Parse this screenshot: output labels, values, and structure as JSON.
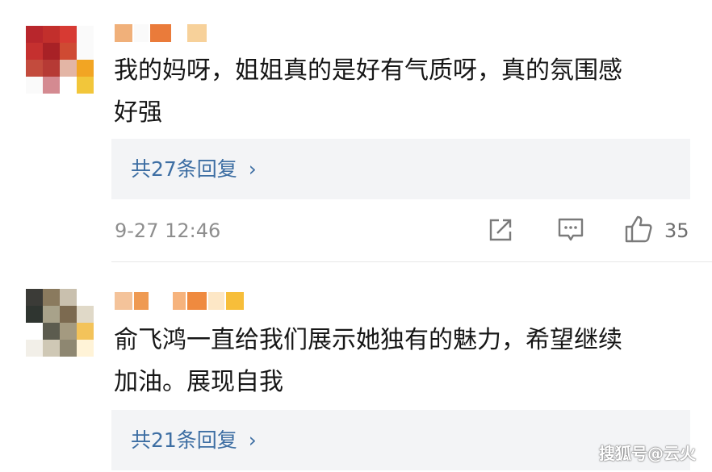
{
  "comments": [
    {
      "text_line1": "我的妈呀，姐姐真的是好有气质呀，真的氛围感",
      "text_line2": "好强",
      "replies": "共27条回复 ",
      "chevron": "›",
      "time": "9-27 12:46",
      "like_count": "35",
      "avatar_colors": [
        "#b8262c",
        "#c22f2c",
        "#d73a33",
        "#fafafa",
        "#c5302f",
        "#a82126",
        "#cf4a33",
        "#fafafa",
        "#c34b3d",
        "#b63a35",
        "#e3b5a5",
        "#f2a523",
        "#fafafa",
        "#d48a91",
        "#ffffff",
        "#f2c63a"
      ],
      "username_colors": [
        "#f0b07a",
        "#fafafa",
        "#ea7b3a",
        "#ffffff",
        "#f7d19a"
      ]
    },
    {
      "text_line1": "俞飞鸿一直给我们展示她独有的魅力，希望继续",
      "text_line2": "加油。展现自我",
      "replies": "共21条回复 ",
      "chevron": "›",
      "avatar_colors": [
        "#3b3b37",
        "#8a7a5e",
        "#c9c0ae",
        "#ffffff",
        "#2f3530",
        "#a8a28a",
        "#7c6a50",
        "#e0d9c8",
        "#ffffff",
        "#5c5c4f",
        "#a49a80",
        "#f3c35a",
        "#f2efe8",
        "#cfc8b5",
        "#8e8771",
        "#fff3d7"
      ],
      "username_colors": [
        "#f4c39a",
        "#ef9a52",
        "#ffffff",
        "#f6b37d",
        "#ef8a3f",
        "#fde7c6",
        "#f7be3a"
      ]
    }
  ],
  "icons": {
    "share": "share-icon",
    "comment": "comment-icon",
    "like": "thumbs-up-icon"
  },
  "watermark": "搜狐号@云火",
  "colors": {
    "reply_link": "#3d6ea3",
    "reply_bg": "#f3f4f6",
    "meta": "#8e8e8e"
  }
}
